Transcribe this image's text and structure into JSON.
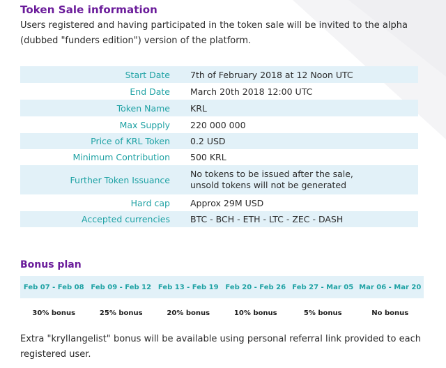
{
  "section_title": "Token Sale information",
  "intro_text": "Users registered and having participated in the token sale will be invited to the alpha (dubbed \"funders edition\") version of the platform.",
  "colors": {
    "heading": "#6a1b9a",
    "label": "#1fa2a4",
    "row_shade": "#e2f1f8"
  },
  "info_rows": [
    {
      "label": "Start Date",
      "value": "7th of February 2018 at 12 Noon UTC"
    },
    {
      "label": "End Date",
      "value": "March 20th 2018 12:00 UTC"
    },
    {
      "label": "Token Name",
      "value": "KRL"
    },
    {
      "label": "Max Supply",
      "value": "220 000 000"
    },
    {
      "label": "Price of KRL Token",
      "value": "0.2 USD"
    },
    {
      "label": "Minimum Contribution",
      "value": "500 KRL"
    },
    {
      "label": "Further Token Issuance",
      "value_line1": "No tokens to be issued after the sale,",
      "value_line2": "unsold tokens will not be generated"
    },
    {
      "label": "Hard cap",
      "value": "Approx 29M USD"
    },
    {
      "label": "Accepted currencies",
      "value": "BTC - BCH - ETH - LTC - ZEC - DASH"
    }
  ],
  "bonus_title": "Bonus plan",
  "bonus_periods": [
    {
      "dates": "Feb 07 - Feb 08",
      "bonus": "30% bonus"
    },
    {
      "dates": "Feb 09 - Feb 12",
      "bonus": "25% bonus"
    },
    {
      "dates": "Feb 13 - Feb 19",
      "bonus": "20% bonus"
    },
    {
      "dates": "Feb 20 - Feb 26",
      "bonus": "10% bonus"
    },
    {
      "dates": "Feb 27 - Mar 05",
      "bonus": "5% bonus"
    },
    {
      "dates": "Mar 06 - Mar 20",
      "bonus": "No bonus"
    }
  ],
  "extra_text": "Extra \"kryllangelist\" bonus will be available using personal referral link provided to each registered user."
}
